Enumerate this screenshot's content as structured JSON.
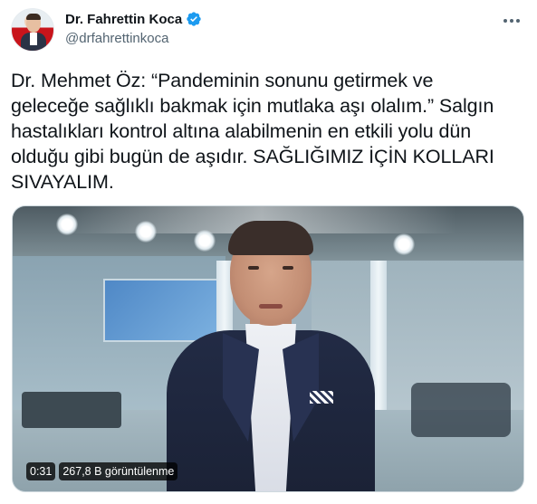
{
  "author": {
    "display_name": "Dr. Fahrettin Koca",
    "handle": "@drfahrettinkoca",
    "verified": true
  },
  "tweet": {
    "lines": [
      "Dr. Mehmet Öz: “Pandeminin sonunu getirmek ve",
      "geleceğe sağlıklı bakmak için mutlaka aşı olalım.” Salgın",
      "hastalıkları kontrol altına alabilmenin en etkili yolu dün",
      "olduğu gibi bugün de aşıdır. SAĞLIĞIMIZ İÇİN KOLLARI",
      "SIVAYALIM."
    ]
  },
  "video": {
    "duration": "0:31",
    "views": "267,8 B görüntülenme"
  },
  "icons": {
    "verified": "verified-badge-icon",
    "more": "more-horizontal-icon"
  },
  "colors": {
    "verified_blue": "#1d9bf0",
    "text_primary": "#0f1419",
    "text_secondary": "#536471"
  }
}
